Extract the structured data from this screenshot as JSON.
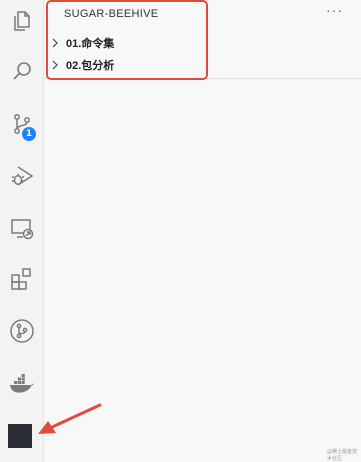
{
  "activity_bar": {
    "icons": [
      "explorer-icon",
      "search-icon",
      "source-control-icon",
      "run-debug-icon",
      "remote-explorer-icon",
      "extensions-icon",
      "git-graph-icon",
      "docker-icon"
    ],
    "scm_badge": "1"
  },
  "sidebar": {
    "title": "SUGAR-BEEHIVE",
    "more_actions": "···",
    "items": [
      {
        "label": "01.命令集"
      },
      {
        "label": "02.包分析"
      }
    ]
  },
  "watermark": "@稀土掘金技术社区",
  "colors": {
    "highlight": "#e14b3b",
    "badge": "#1a85ff",
    "icon": "#7b7b7b"
  }
}
